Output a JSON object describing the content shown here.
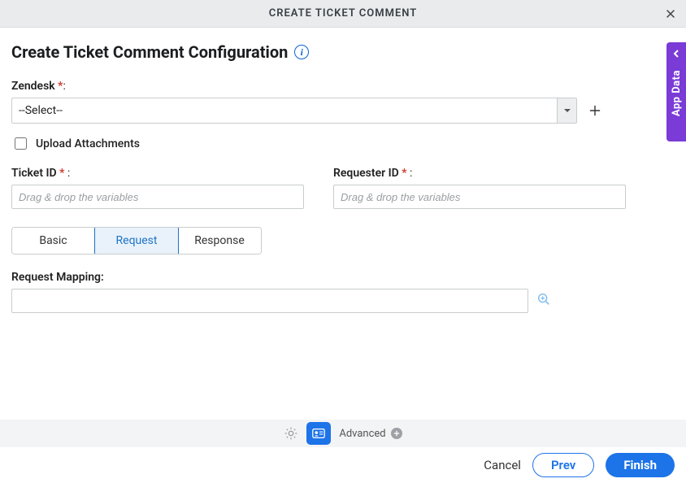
{
  "titlebar": {
    "text": "CREATE TICKET COMMENT"
  },
  "page": {
    "heading": "Create Ticket Comment Configuration"
  },
  "fields": {
    "zendesk": {
      "label": "Zendesk",
      "colon_suffix": ":",
      "value": "--Select--"
    },
    "upload_attachments": {
      "label": "Upload Attachments"
    },
    "ticket_id": {
      "label": "Ticket ID",
      "colon_suffix": " :",
      "placeholder": "Drag & drop the variables"
    },
    "requester_id": {
      "label": "Requester ID",
      "colon_suffix": " :",
      "placeholder": "Drag & drop the variables"
    }
  },
  "tabs": {
    "basic": "Basic",
    "request": "Request",
    "response": "Response",
    "active": "request"
  },
  "request": {
    "mapping_label": "Request Mapping:",
    "mapping_value": ""
  },
  "toolbar": {
    "advanced_label": "Advanced"
  },
  "footer": {
    "cancel": "Cancel",
    "prev": "Prev",
    "finish": "Finish"
  },
  "side_panel": {
    "label": "App Data"
  },
  "colors": {
    "accent": "#1d73e8",
    "side_panel": "#7a3bd6",
    "required": "#d0362a"
  }
}
